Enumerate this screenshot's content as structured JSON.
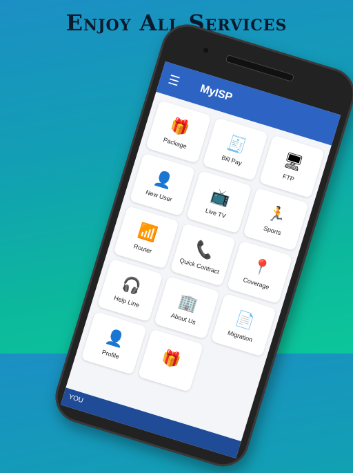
{
  "headline": "Enjoy All Services",
  "app": {
    "title": "MyISP",
    "menu_icon": "hamburger-icon",
    "brand_color": "#2d63c2"
  },
  "tiles": [
    {
      "label": "Package",
      "icon": "🎁"
    },
    {
      "label": "Bill Pay",
      "icon": "🧾"
    },
    {
      "label": "FTP",
      "icon": "🖥"
    },
    {
      "label": "New User",
      "icon": "👤"
    },
    {
      "label": "Live TV",
      "icon": "📺"
    },
    {
      "label": "Sports",
      "icon": "🏃"
    },
    {
      "label": "Router",
      "icon": "📶"
    },
    {
      "label": "Quick Contract",
      "icon": "📞"
    },
    {
      "label": "Coverage",
      "icon": "📍"
    },
    {
      "label": "Help Line",
      "icon": "🎧"
    },
    {
      "label": "About Us",
      "icon": "🏢"
    },
    {
      "label": "Migration",
      "icon": "📄"
    },
    {
      "label": "Profile",
      "icon": "👤"
    },
    {
      "label": "",
      "icon": "🎁"
    }
  ],
  "footer": {
    "text": "YOU"
  }
}
